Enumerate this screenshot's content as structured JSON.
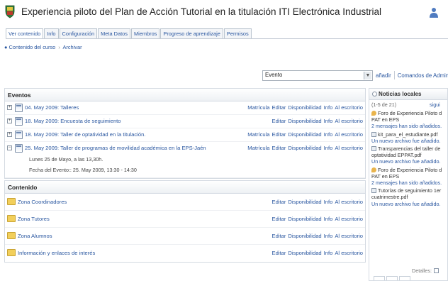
{
  "header": {
    "title": "Experiencia piloto del Plan de Acción Tutorial en la titulación ITI Electrónica Industrial",
    "logo_icon": "coat-of-arms-icon",
    "user_icon": "user-icon"
  },
  "tabs": [
    {
      "label": "Ver contenido"
    },
    {
      "label": "Info"
    },
    {
      "label": "Configuración"
    },
    {
      "label": "Meta Datos"
    },
    {
      "label": "Miembros"
    },
    {
      "label": "Progreso de aprendizaje"
    },
    {
      "label": "Permisos"
    }
  ],
  "breadcrumb": {
    "item1": "Contenido del curso",
    "separator": "›",
    "item2": "Archivar"
  },
  "toolbar": {
    "select_value": "Evento",
    "add_label": "añadir",
    "admin_label": "Comandos de Administra"
  },
  "events": {
    "heading": "Eventos",
    "rows": [
      {
        "title": "04. May 2009: Talleres",
        "actions": [
          "Matrícula",
          "Editar",
          "Disponibilidad",
          "Info",
          "Al escritorio"
        ]
      },
      {
        "title": "18. May 2009: Encuesta de seguimiento",
        "actions": [
          "Editar",
          "Disponibilidad",
          "Info",
          "Al escritorio"
        ]
      },
      {
        "title": "18. May 2009: Taller de optatividad en la titulación.",
        "actions": [
          "Matrícula",
          "Editar",
          "Disponibilidad",
          "Info",
          "Al escritorio"
        ]
      },
      {
        "title": "25. May 2009: Taller de programas de movilidad académica en la EPS-Jaén",
        "actions": [
          "Matrícula",
          "Editar",
          "Disponibilidad",
          "Info",
          "Al escritorio"
        ],
        "detail1": "Lunes 25 de Mayo, a las 13,30h.",
        "detail2": "Fecha del Evento:: 25. May 2009, 13:30 - 14:30"
      }
    ]
  },
  "content": {
    "heading": "Contenido",
    "rows": [
      {
        "title": "Zona Coordinadores",
        "actions": [
          "Editar",
          "Disponibilidad",
          "Info",
          "Al escritorio"
        ]
      },
      {
        "title": "Zona Tutores",
        "actions": [
          "Editar",
          "Disponibilidad",
          "Info",
          "Al escritorio"
        ]
      },
      {
        "title": "Zona Alumnos",
        "actions": [
          "Editar",
          "Disponibilidad",
          "Info",
          "Al escritorio"
        ]
      },
      {
        "title": "Información y enlaces de interés",
        "actions": [
          "Editar",
          "Disponibilidad",
          "Info",
          "Al escritorio"
        ]
      }
    ]
  },
  "news": {
    "heading": "Noticias locales",
    "pager": "(1-5 de 21)",
    "next": "sigui",
    "items": [
      {
        "icon": "forum-icon",
        "lines": [
          "Foro de Experiencia Piloto d",
          "PAT en EPS"
        ],
        "sub": "2 mensajes han sido añadidos."
      },
      {
        "icon": "file-icon",
        "lines": [
          "kit_para_el_estudiante.pdf"
        ],
        "sub": "Un nuevo archivo fue añadido."
      },
      {
        "icon": "file-icon",
        "lines": [
          "Transparencias del taller de",
          "optatividad EPPAT.pdf"
        ],
        "sub": "Un nuevo archivo fue añadido."
      },
      {
        "icon": "forum-icon",
        "lines": [
          "Foro de Experiencia Piloto d",
          "PAT en EPS"
        ],
        "sub": "2 mensajes han sido añadidos."
      },
      {
        "icon": "file-icon",
        "lines": [
          "Tutorías de seguimiento 1er",
          "cuatrimestre.pdf"
        ],
        "sub": "Un nuevo archivo fue añadido."
      }
    ],
    "footer": "Detalles:"
  }
}
